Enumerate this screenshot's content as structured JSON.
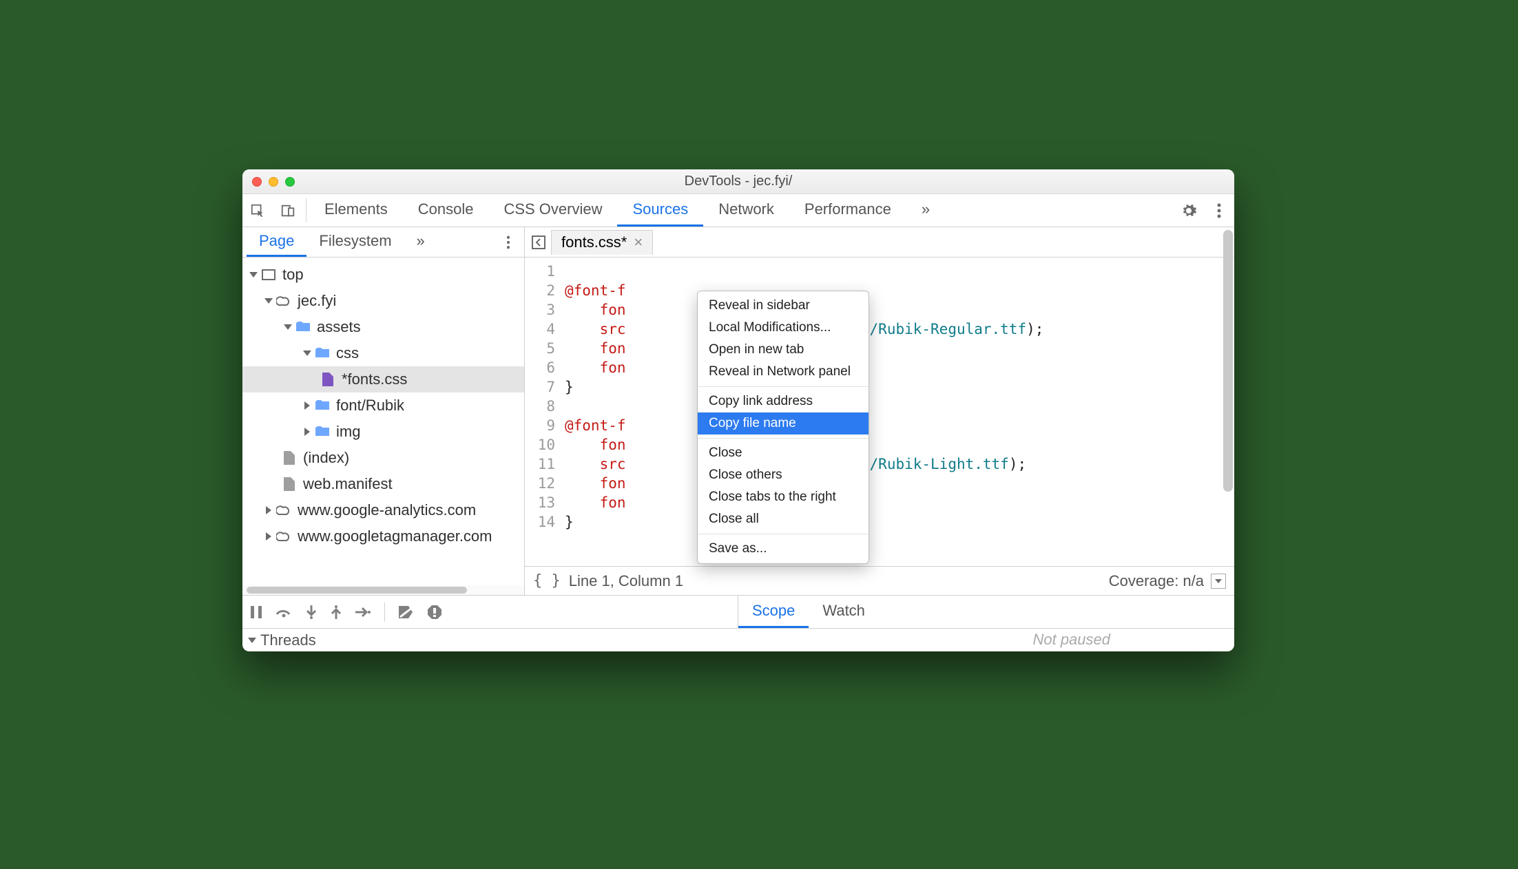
{
  "window": {
    "title": "DevTools - jec.fyi/"
  },
  "toptabs": {
    "items": [
      "Elements",
      "Console",
      "CSS Overview",
      "Sources",
      "Network",
      "Performance"
    ],
    "active": "Sources",
    "overflow": "»"
  },
  "leftnav": {
    "tabs": [
      "Page",
      "Filesystem"
    ],
    "active": "Page",
    "overflow": "»",
    "tree": {
      "top": "top",
      "domain": "jec.fyi",
      "assets": "assets",
      "css": "css",
      "fontscss": "*fonts.css",
      "fontrubik": "font/Rubik",
      "img": "img",
      "index": "(index)",
      "webmanifest": "web.manifest",
      "ga": "www.google-analytics.com",
      "gtm": "www.googletagmanager.com"
    }
  },
  "filetab": {
    "name": "fonts.css*",
    "close": "×"
  },
  "code": {
    "l1a": "@font-f",
    "l2": "fon",
    "l3a": "src",
    "l3b": "Rubik/Rubik-Regular.ttf",
    "l3c": ");",
    "l4": "fon",
    "l5": "fon",
    "l6": "}",
    "l7": "",
    "l8": "@font-f",
    "l9": "fon",
    "l10a": "src",
    "l10b": "Rubik/Rubik-Light.ttf",
    "l10c": ");",
    "l11": "fon",
    "l12": "fon",
    "l13": "}",
    "l14": ""
  },
  "gutter": [
    "1",
    "2",
    "3",
    "4",
    "5",
    "6",
    "7",
    "8",
    "9",
    "10",
    "11",
    "12",
    "13",
    "14"
  ],
  "status": {
    "pos": "Line 1, Column 1",
    "coverage": "Coverage: n/a"
  },
  "debug": {
    "tabs": [
      "Scope",
      "Watch"
    ],
    "active": "Scope",
    "threads_label": "Threads",
    "notpaused": "Not paused"
  },
  "ctx": {
    "reveal_sidebar": "Reveal in sidebar",
    "local_mod": "Local Modifications...",
    "open_new_tab": "Open in new tab",
    "reveal_network": "Reveal in Network panel",
    "copy_link": "Copy link address",
    "copy_file": "Copy file name",
    "close": "Close",
    "close_others": "Close others",
    "close_right": "Close tabs to the right",
    "close_all": "Close all",
    "save_as": "Save as..."
  }
}
